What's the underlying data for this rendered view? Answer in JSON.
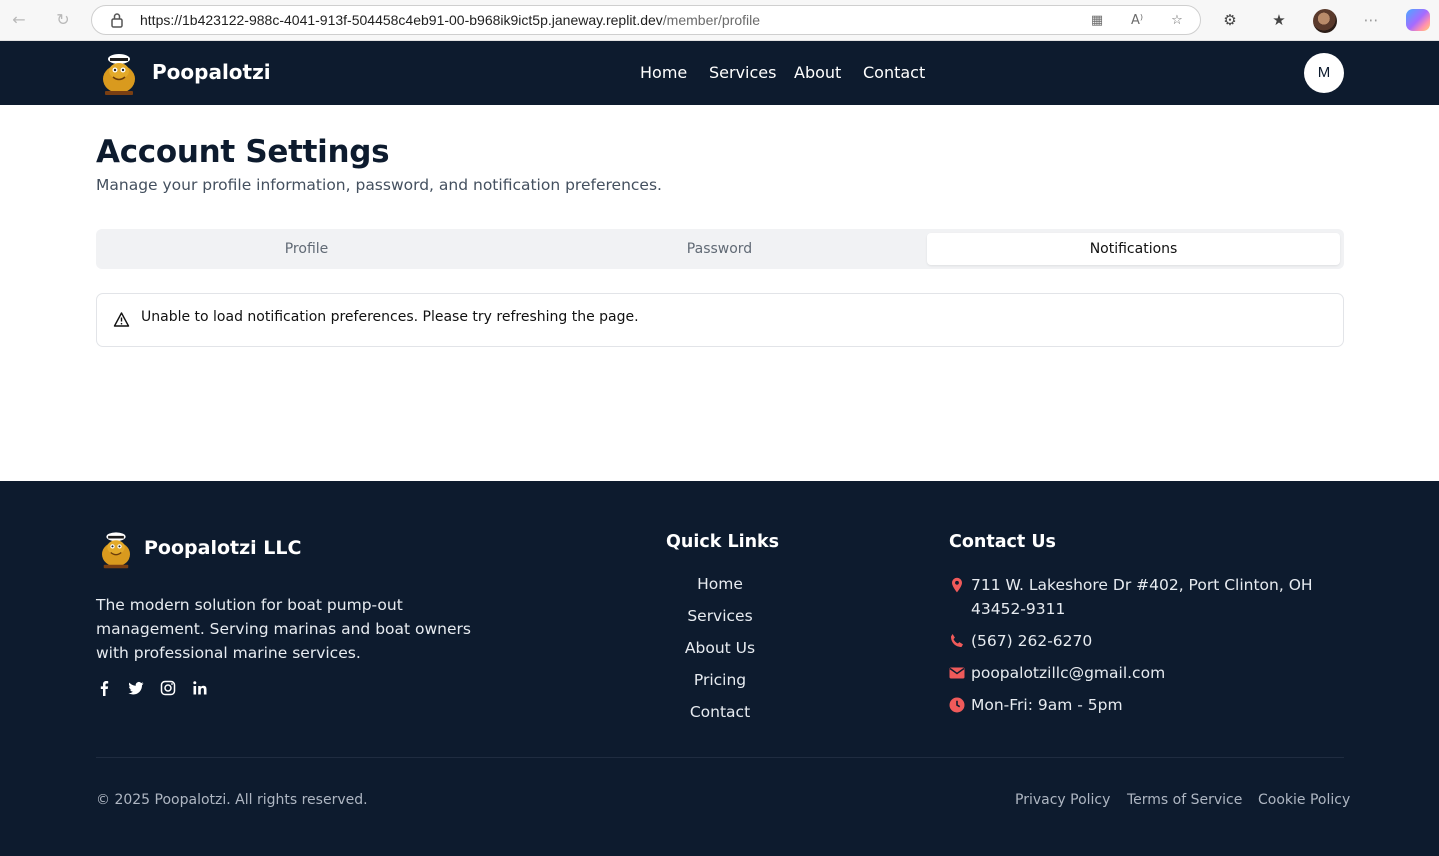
{
  "browser": {
    "url_host": "https://1b423122-988c-4041-913f-504458c4eb91-00-b968ik9ict5p.janeway.replit.dev",
    "url_path": "/member/profile"
  },
  "header": {
    "brand": "Poopalotzi",
    "nav": [
      "Home",
      "Services",
      "About",
      "Contact"
    ],
    "avatar_initial": "M"
  },
  "main": {
    "title": "Account Settings",
    "subtitle": "Manage your profile information, password, and notification preferences.",
    "tabs": [
      {
        "label": "Profile",
        "active": false
      },
      {
        "label": "Password",
        "active": false
      },
      {
        "label": "Notifications",
        "active": true
      }
    ],
    "alert": "Unable to load notification preferences. Please try refreshing the page."
  },
  "footer": {
    "brand": "Poopalotzi LLC",
    "description": "The modern solution for boat pump-out management. Serving marinas and boat owners with professional marine services.",
    "social_icons": [
      "facebook-icon",
      "twitter-icon",
      "instagram-icon",
      "linkedin-icon"
    ],
    "quick_links_heading": "Quick Links",
    "quick_links": [
      "Home",
      "Services",
      "About Us",
      "Pricing",
      "Contact"
    ],
    "contact_heading": "Contact Us",
    "contact": {
      "address": "711 W. Lakeshore Dr #402, Port Clinton, OH 43452-9311",
      "phone": "(567) 262-6270",
      "email": "poopalotzillc@gmail.com",
      "hours": "Mon-Fri: 9am - 5pm"
    },
    "copyright": "© 2025 Poopalotzi. All rights reserved.",
    "legal_links": [
      "Privacy Policy",
      "Terms of Service",
      "Cookie Policy"
    ]
  },
  "colors": {
    "navy": "#0d1b2e",
    "accent_red": "#ef5a5a"
  }
}
